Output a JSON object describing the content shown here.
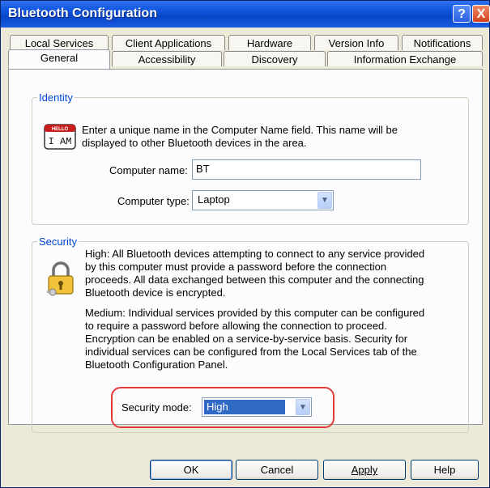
{
  "window": {
    "title": "Bluetooth Configuration"
  },
  "titlebar": {
    "help_glyph": "?",
    "close_glyph": "X"
  },
  "tabs": {
    "row1": [
      "Local Services",
      "Client Applications",
      "Hardware",
      "Version Info",
      "Notifications"
    ],
    "row2": [
      "General",
      "Accessibility",
      "Discovery",
      "Information Exchange"
    ],
    "active": "General"
  },
  "identity": {
    "legend": "Identity",
    "icon": "i-am-badge-icon",
    "badge_top": "HELLO",
    "badge_text": "I AM",
    "description_line1": "Enter a unique name in the Computer Name field. This name will be",
    "description_line2": "displayed to other Bluetooth devices in the area.",
    "computer_name_label": "Computer name:",
    "computer_name_value": "BT",
    "computer_type_label": "Computer type:",
    "computer_type_value": "Laptop"
  },
  "security": {
    "legend": "Security",
    "icon": "padlock-keys-icon",
    "high_lines": [
      "High: All Bluetooth devices attempting to connect to any service provided",
      "by this computer must provide a password before the connection",
      "proceeds. All data exchanged between this computer and the connecting",
      "Bluetooth device is encrypted."
    ],
    "medium_lines": [
      "Medium: Individual services provided by this computer can be configured",
      "to require a password before allowing the connection to proceed.",
      "Encryption can be enabled on a service-by-service basis. Security for",
      "individual services can be configured from the Local Services tab of the",
      "Bluetooth Configuration Panel."
    ],
    "mode_label": "Security mode:",
    "mode_value": "High"
  },
  "buttons": {
    "ok": "OK",
    "cancel": "Cancel",
    "apply": "Apply",
    "help": "Help"
  },
  "colors": {
    "title_bar": "#0a50d8",
    "legend_text": "#0046d5",
    "selection": "#316ac5",
    "annotation": "#e23a3a"
  }
}
